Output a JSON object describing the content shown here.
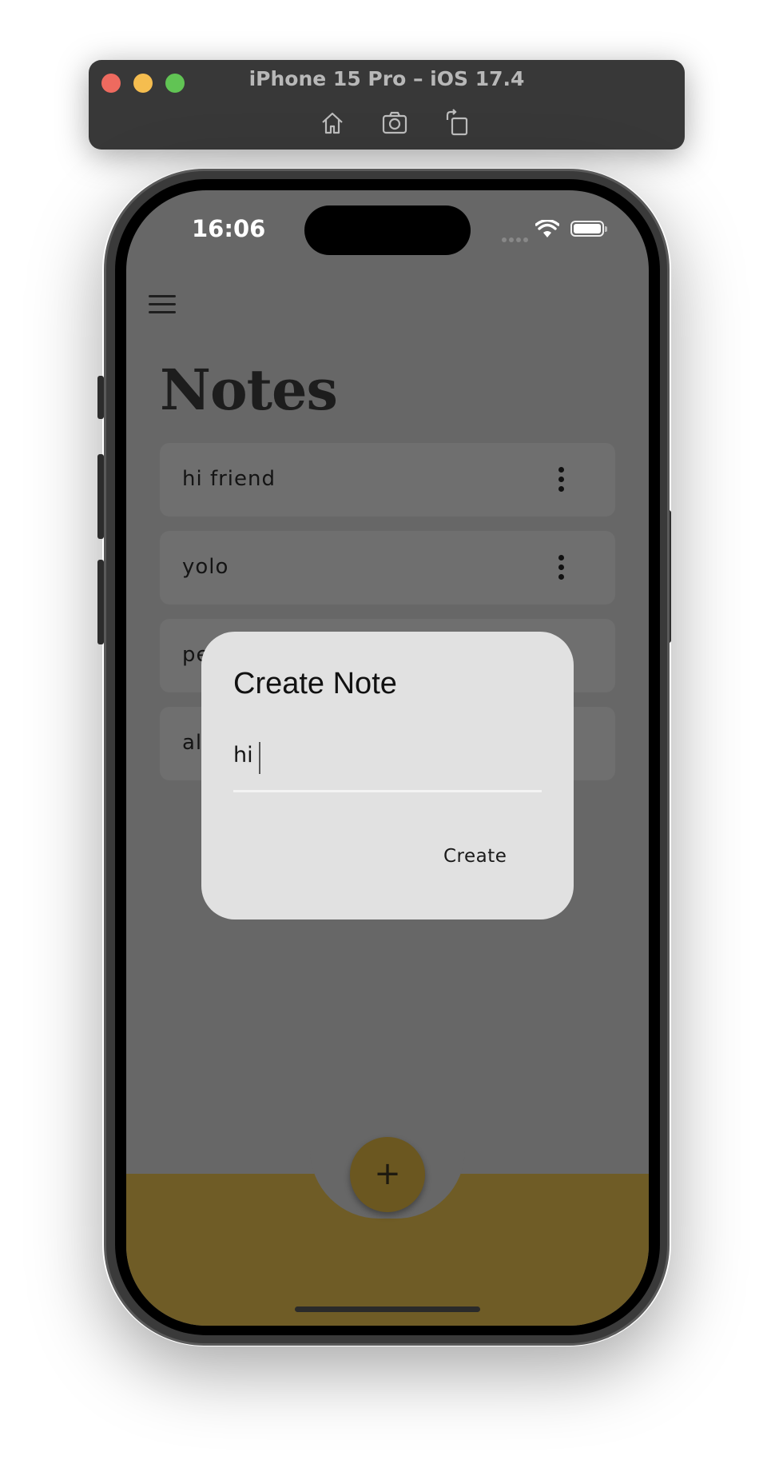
{
  "simulator": {
    "title": "iPhone 15 Pro – iOS 17.4",
    "tools": [
      "home-icon",
      "screenshot-icon",
      "rotate-icon"
    ]
  },
  "status_bar": {
    "time": "16:06",
    "icons": [
      "signal-icon",
      "wifi-icon",
      "battery-icon"
    ]
  },
  "app": {
    "title": "Notes",
    "notes": [
      {
        "text": "hi friend"
      },
      {
        "text": "yolo"
      },
      {
        "text": "pe"
      },
      {
        "text": "al"
      }
    ],
    "fab_label": "+"
  },
  "dialog": {
    "title": "Create Note",
    "input_value": "hi",
    "action_label": "Create"
  },
  "colors": {
    "barrier": "#676767",
    "dialog": "#e1e1e1",
    "accent": "#6f5c26"
  }
}
